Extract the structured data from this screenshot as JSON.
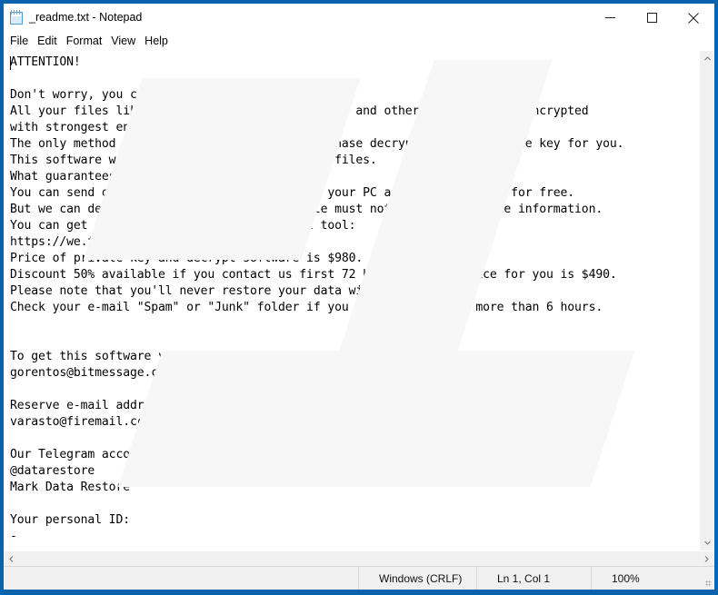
{
  "window": {
    "title": "_readme.txt - Notepad",
    "icon": "notepad-icon",
    "border_color": "#0b63ad",
    "controls": {
      "minimize": "minimize-icon",
      "maximize": "maximize-icon",
      "close": "close-icon"
    }
  },
  "menubar": {
    "items": [
      {
        "label": "File"
      },
      {
        "label": "Edit"
      },
      {
        "label": "Format"
      },
      {
        "label": "View"
      },
      {
        "label": "Help"
      }
    ]
  },
  "document": {
    "lines": [
      "ATTENTION!",
      "",
      "Don't worry, you can return all your files!",
      "All your files like photos, databases, documents and other important are encrypted",
      "with strongest encryption and unique key.",
      "The only method of recovering files is to purchase decrypt tool and unique key for you.",
      "This software will decrypt all your encrypted files.",
      "What guarantees you have?",
      "You can send one of your encrypted file from your PC and we decrypt it for free.",
      "But we can decrypt only 1 file for free. File must not contain valuable information.",
      "You can get and look video overview decrypt tool:",
      "https://we.tl/t-JBwR4re7bR",
      "Price of private key and decrypt software is $980.",
      "Discount 50% available if you contact us first 72 hours, that's price for you is $490.",
      "Please note that you'll never restore your data without payment.",
      "Check your e-mail \"Spam\" or \"Junk\" folder if you don't get answer more than 6 hours.",
      "",
      "",
      "To get this software you need write on our e-mail:",
      "gorentos@bitmessage.ch",
      "",
      "Reserve e-mail address to contact us:",
      "varasto@firemail.cc",
      "",
      "Our Telegram account:",
      "@datarestore",
      "Mark Data Restore",
      "",
      "Your personal ID:",
      "-"
    ],
    "contacts": {
      "primary_email": "gorentos@bitmessage.ch",
      "reserve_email": "varasto@firemail.cc",
      "telegram": "@datarestore",
      "telegram_name": "Mark Data Restore",
      "video_url": "https://we.tl/t-JBwR4re7bR",
      "price_full": "$980",
      "price_discount": "$490",
      "discount_percent": "50%",
      "discount_window": "72 hours",
      "personal_id": "-"
    }
  },
  "scrollbars": {
    "vertical": {
      "up": "chevron-up-icon",
      "down": "chevron-down-icon"
    },
    "horizontal": {
      "left": "chevron-left-icon",
      "right": "chevron-right-icon"
    }
  },
  "statusbar": {
    "line_ending": "Windows (CRLF)",
    "position": "Ln 1, Col 1",
    "zoom": "100%"
  }
}
